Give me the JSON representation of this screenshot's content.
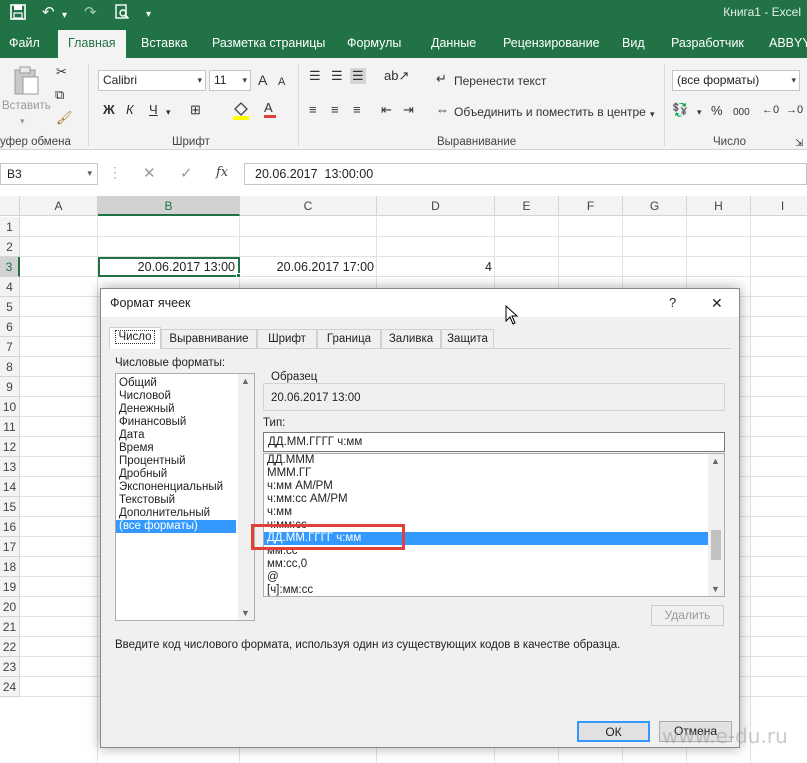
{
  "window": {
    "title": "Книга1 - Excel"
  },
  "quick_access": {
    "save_icon": "save-icon",
    "undo_icon": "undo-icon",
    "redo_icon": "redo-icon",
    "preview_icon": "print-preview-icon",
    "customize_icon": "customize-icon"
  },
  "ribbon_tabs": [
    "Файл",
    "Главная",
    "Вставка",
    "Разметка страницы",
    "Формулы",
    "Данные",
    "Рецензирование",
    "Вид",
    "Разработчик",
    "ABBYY"
  ],
  "ribbon": {
    "clipboard": {
      "paste_label": "Вставить",
      "group_label": "уфер обмена"
    },
    "font": {
      "name": "Calibri",
      "size": "11",
      "grow": "A",
      "shrink": "A",
      "bold": "Ж",
      "italic": "К",
      "underline": "Ч",
      "group_label": "Шрифт"
    },
    "alignment": {
      "wrap_label": "Перенести текст",
      "merge_label": "Объединить и поместить в центре",
      "group_label": "Выравнивание"
    },
    "number": {
      "format": "(все форматы)",
      "percent": "%",
      "thousands": "000",
      "group_label": "Число"
    }
  },
  "formula_bar": {
    "name_box": "B3",
    "fx": "fx",
    "value": "20.06.2017  13:00:00"
  },
  "sheet": {
    "columns": [
      "A",
      "B",
      "C",
      "D",
      "E",
      "F",
      "G",
      "H",
      "I"
    ],
    "rows": [
      "1",
      "2",
      "3",
      "4",
      "5",
      "6",
      "7",
      "8",
      "9",
      "10",
      "11",
      "12",
      "13",
      "14",
      "15",
      "16",
      "17",
      "18",
      "19",
      "20",
      "21",
      "22",
      "23",
      "24"
    ],
    "cells": {
      "B3": "20.06.2017 13:00",
      "C3": "20.06.2017 17:00",
      "D3": "4"
    }
  },
  "dialog": {
    "title": "Формат ячеек",
    "help": "?",
    "close": "✕",
    "tabs": [
      "Число",
      "Выравнивание",
      "Шрифт",
      "Граница",
      "Заливка",
      "Защита"
    ],
    "formats_label": "Числовые форматы:",
    "formats": [
      "Общий",
      "Числовой",
      "Денежный",
      "Финансовый",
      "Дата",
      "Время",
      "Процентный",
      "Дробный",
      "Экспоненциальный",
      "Текстовый",
      "Дополнительный",
      "(все форматы)"
    ],
    "selected_format": "(все форматы)",
    "sample_label": "Образец",
    "sample_value": "20.06.2017 13:00",
    "type_label": "Тип:",
    "type_value": "ДД.ММ.ГГГГ ч:мм",
    "type_list": [
      "ДД.МММ",
      "МММ.ГГ",
      "ч:мм AM/PM",
      "ч:мм:сс AM/PM",
      "ч:мм",
      "ч:мм:сс",
      "ДД.ММ.ГГГГ ч:мм",
      "мм:сс",
      "мм:сс,0",
      "@",
      "[ч]:мм:сс"
    ],
    "selected_type": "ДД.ММ.ГГГГ ч:мм",
    "delete_button": "Удалить",
    "hint": "Введите код числового формата, используя один из существующих кодов в качестве образца.",
    "ok_button": "ОК",
    "cancel_button": "Отмена"
  },
  "watermark": "www.e-du.ru",
  "colors": {
    "excel_green": "#217346",
    "selection_blue": "#3399ff",
    "highlight_red": "#e0413c"
  }
}
